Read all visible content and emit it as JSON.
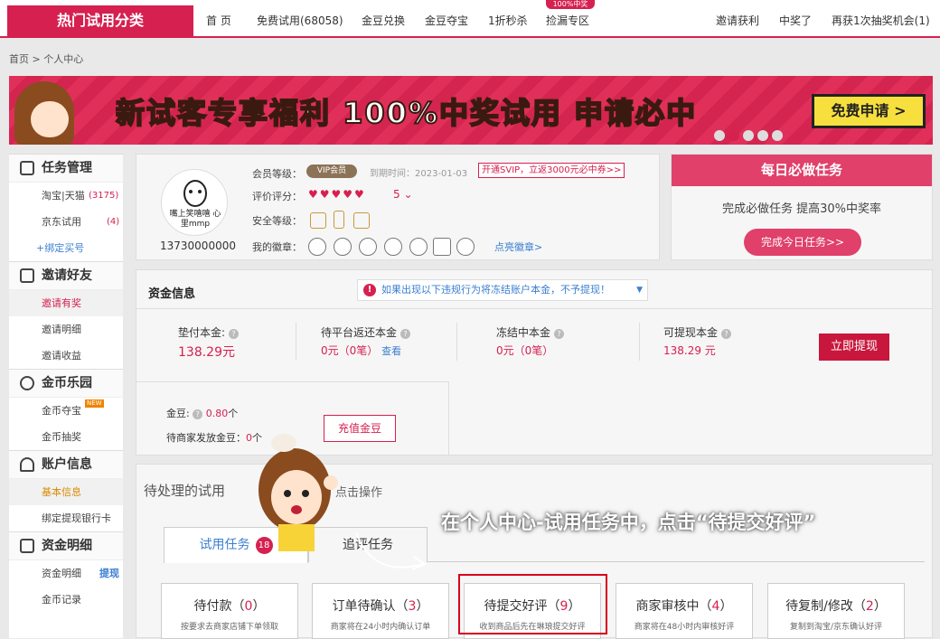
{
  "nav": {
    "category": "热门试用分类",
    "links": [
      "首 页",
      "免费试用(68058)",
      "金豆兑换",
      "金豆夺宝",
      "1折秒杀",
      "捡漏专区"
    ],
    "badge": "100%中奖",
    "right": [
      "邀请获利",
      "中奖了",
      "再获1次抽奖机会(1)"
    ]
  },
  "breadcrumb": "首页 > 个人中心",
  "banner": {
    "text": "新试客专享福利 100%中奖试用 申请必中",
    "button": "免费申请 >"
  },
  "sidebar": {
    "sections": [
      {
        "title": "任务管理",
        "icon": "task-list-icon",
        "items": [
          {
            "label": "淘宝|天猫",
            "count": "(3175)"
          },
          {
            "label": "京东试用",
            "count": "(4)"
          },
          {
            "label": "+绑定买号"
          }
        ]
      },
      {
        "title": "邀请好友",
        "icon": "invite-icon",
        "items": [
          {
            "label": "邀请有奖"
          },
          {
            "label": "邀请明细"
          },
          {
            "label": "邀请收益"
          }
        ]
      },
      {
        "title": "金币乐园",
        "icon": "coin-icon",
        "items": [
          {
            "label": "金币夺宝",
            "badge": "NEW"
          },
          {
            "label": "金币抽奖"
          }
        ]
      },
      {
        "title": "账户信息",
        "icon": "user-icon",
        "items": [
          {
            "label": "基本信息"
          },
          {
            "label": "绑定提现银行卡"
          }
        ]
      },
      {
        "title": "资金明细",
        "icon": "wallet-icon",
        "items": [
          {
            "label": "资金明细",
            "tag": "提现"
          },
          {
            "label": "金币记录"
          }
        ]
      }
    ]
  },
  "profile": {
    "avatar_text": "嘴上笑嘻嘻 心里mmp",
    "phone": "13730000000",
    "labels": [
      "会员等级：",
      "评价评分：",
      "安全等级：",
      "我的徽章："
    ],
    "vip": "VIP会员",
    "expire": "到期时间：2023-01-03",
    "svip": "开通SVIP，立返3000元必中券>>",
    "hearts": "♥♥♥♥♥",
    "score": "5",
    "light_badges": "点亮徽章>"
  },
  "daily": {
    "title": "每日必做任务",
    "text": "完成必做任务 提高30%中奖率",
    "button": "完成今日任务>>"
  },
  "funds": {
    "title": "资金信息",
    "notice": "如果出现以下违规行为将冻结账户本金，不予提现！",
    "items": [
      {
        "label": "垫付本金:",
        "value": "138.29元"
      },
      {
        "label": "待平台返还本金",
        "value": "0元（0笔）",
        "link": "查看"
      },
      {
        "label": "冻结中本金",
        "value": "0元（0笔）"
      },
      {
        "label": "可提现本金",
        "value": "138.29 元"
      }
    ],
    "withdraw": "立即提现",
    "bean_label": "金豆:",
    "bean_value": "0.80",
    "bean_unit": "个",
    "pending_label": "待商家发放金豆：",
    "pending_value": "0",
    "pending_unit": "个",
    "recharge": "充值金豆"
  },
  "pending": {
    "title": "待处理的试用",
    "op": "点击操作",
    "tabs": [
      {
        "label": "试用任务",
        "badge": "18"
      },
      {
        "label": "追评任务"
      }
    ],
    "cards": [
      {
        "title": "待付款",
        "num": "0",
        "sub": "按要求去商家店铺下单领取"
      },
      {
        "title": "订单待确认",
        "num": "3",
        "sub": "商家将在24小时内确认订单"
      },
      {
        "title": "待提交好评",
        "num": "9",
        "sub": "收到商品后先在琳琅提交好评"
      },
      {
        "title": "商家审核中",
        "num": "4",
        "sub": "商家将在48小时内审核好评"
      },
      {
        "title": "待复制/修改",
        "num": "2",
        "sub": "复制到淘宝/京东确认好评"
      }
    ]
  },
  "caption": "在个人中心-试用任务中，点击“待提交好评”",
  "colors": {
    "brand": "#d6204f",
    "link": "#3b7fd1"
  }
}
